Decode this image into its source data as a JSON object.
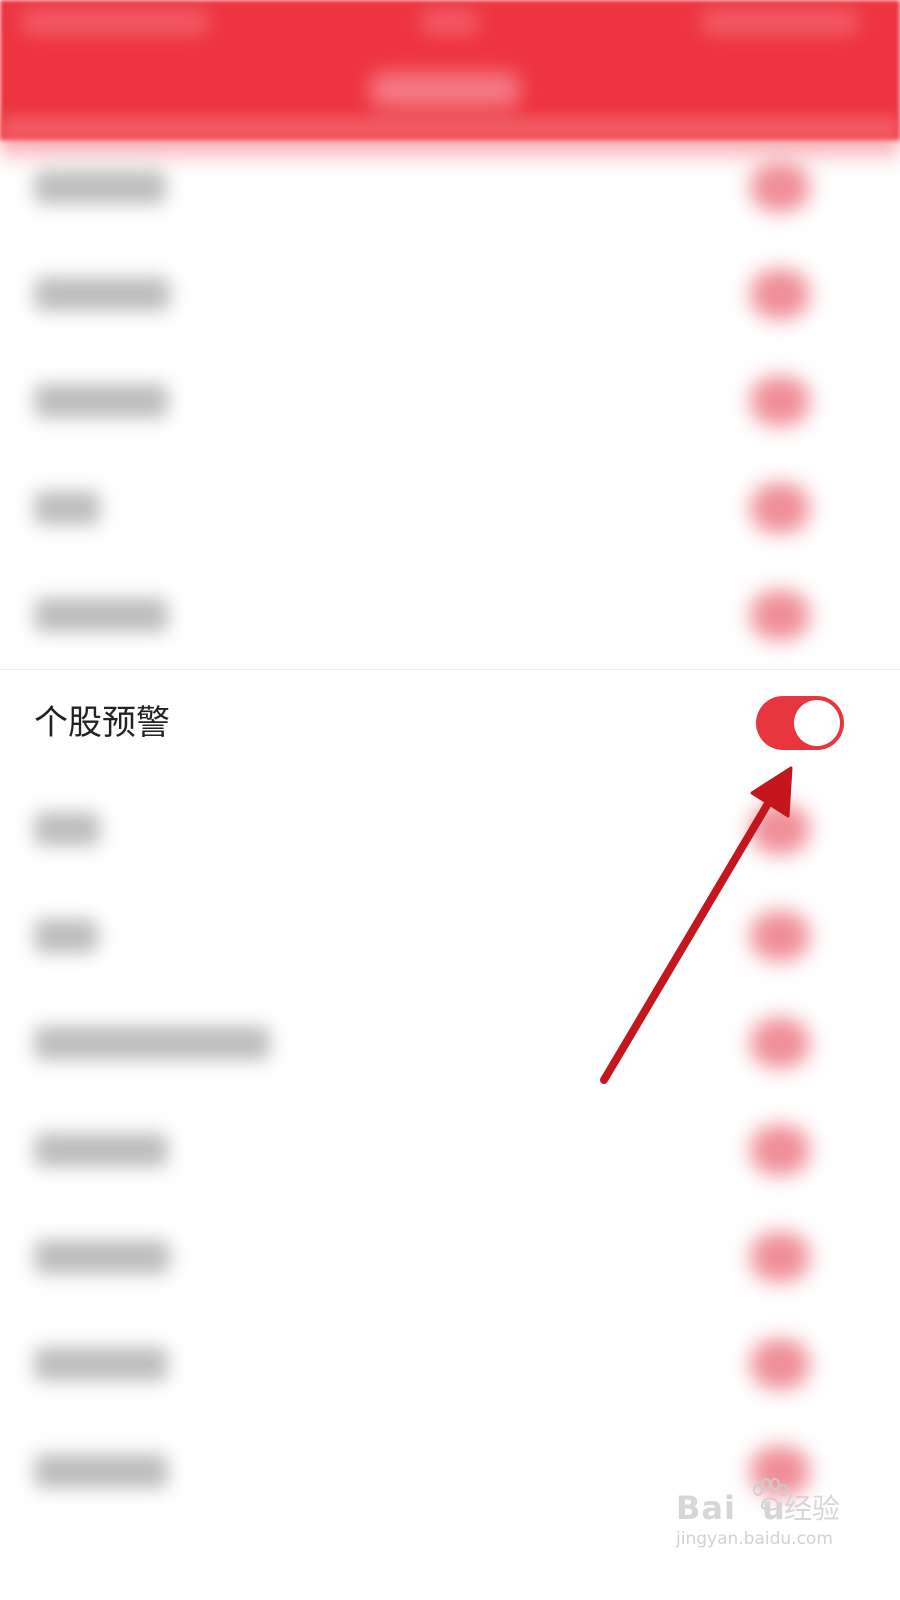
{
  "setting_row": {
    "label": "个股预警",
    "toggle_state": "on"
  },
  "colors": {
    "header": "#ee3440",
    "toggle_on": "#e8363f",
    "arrow": "#c4161c"
  },
  "watermark": {
    "brand": "Bai",
    "brand_tail": "u",
    "label": "经验",
    "url": "jingyan.baidu.com"
  }
}
